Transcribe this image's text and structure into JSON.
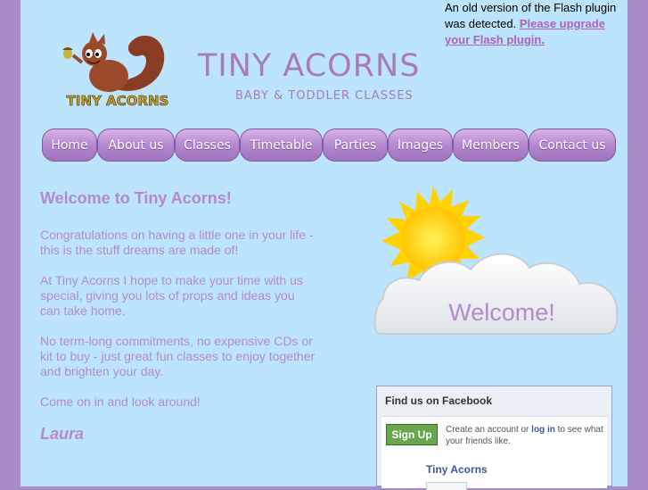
{
  "flash_notice": {
    "text": "An old version of the Flash plugin was detected.",
    "link": "Please upgrade your Flash plugin."
  },
  "header": {
    "logo_icon": "squirrel-holding-acorn-logo",
    "logo_text": "TINY ACORNS",
    "title": "TINY ACORNS",
    "subtitle": "BABY & TODDLER CLASSES"
  },
  "nav": {
    "home": "Home",
    "about": "About us",
    "classes": "Classes",
    "timetable": "Timetable",
    "parties": "Parties",
    "images": "Images",
    "members": "Members",
    "contact": "Contact us"
  },
  "main": {
    "heading": "Welcome to Tiny Acorns!",
    "p1": "Congratulations on having a little one in your life - this is the stuff dreams are made of!",
    "p2": "At Tiny Acorns I hope to make your time with us special, giving you lots of props and ideas you can take home.",
    "p3": "No term-long commitments, no expensive CDs or kit to buy - just great fun classes to enjoy together and brighten your day.",
    "p4": "Come on in and look around!",
    "signoff": "Laura"
  },
  "banner": {
    "icon": "sun-behind-cloud-icon",
    "text": "Welcome!"
  },
  "facebook": {
    "title": "Find us on Facebook",
    "signup": "Sign Up",
    "text_before": "Create an account or ",
    "login_link": "log in",
    "text_after": " to see what your friends like.",
    "page_name": "Tiny Acorns"
  },
  "colors": {
    "background": "#a98bc9",
    "page": "#bde4fd",
    "accent": "#b58acd",
    "nav_button": "#b688d0",
    "facebook_blue": "#3b5998"
  }
}
